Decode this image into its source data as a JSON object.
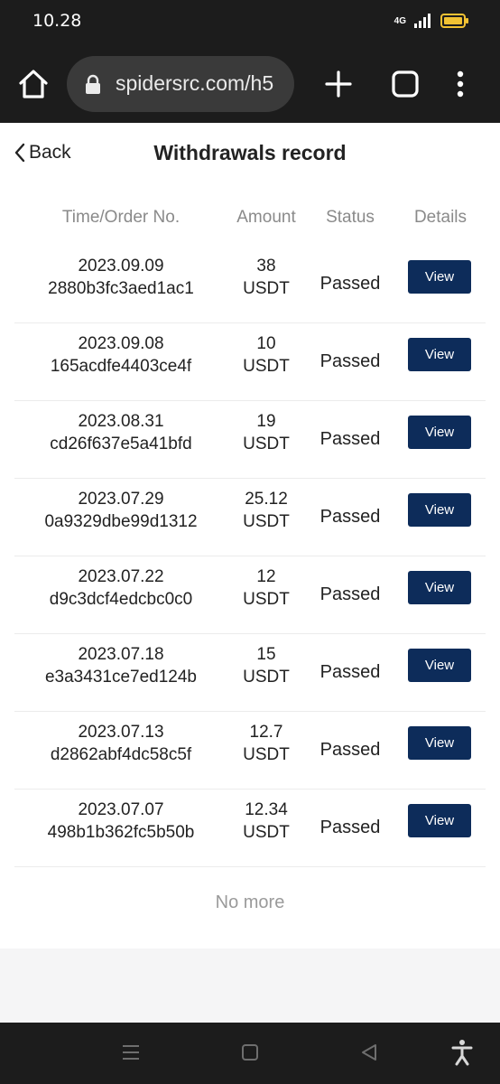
{
  "status_bar": {
    "time": "10.28",
    "network": "4G"
  },
  "browser": {
    "url": "spidersrc.com/h5"
  },
  "page": {
    "back_label": "Back",
    "title": "Withdrawals record",
    "columns": {
      "time": "Time/Order No.",
      "amount": "Amount",
      "status": "Status",
      "details": "Details"
    },
    "records": [
      {
        "date": "2023.09.09",
        "order": "2880b3fc3aed1ac1",
        "amount": "38",
        "unit": "USDT",
        "status": "Passed",
        "action": "View"
      },
      {
        "date": "2023.09.08",
        "order": "165acdfe4403ce4f",
        "amount": "10",
        "unit": "USDT",
        "status": "Passed",
        "action": "View"
      },
      {
        "date": "2023.08.31",
        "order": "cd26f637e5a41bfd",
        "amount": "19",
        "unit": "USDT",
        "status": "Passed",
        "action": "View"
      },
      {
        "date": "2023.07.29",
        "order": "0a9329dbe99d1312",
        "amount": "25.12",
        "unit": "USDT",
        "status": "Passed",
        "action": "View"
      },
      {
        "date": "2023.07.22",
        "order": "d9c3dcf4edcbc0c0",
        "amount": "12",
        "unit": "USDT",
        "status": "Passed",
        "action": "View"
      },
      {
        "date": "2023.07.18",
        "order": "e3a3431ce7ed124b",
        "amount": "15",
        "unit": "USDT",
        "status": "Passed",
        "action": "View"
      },
      {
        "date": "2023.07.13",
        "order": "d2862abf4dc58c5f",
        "amount": "12.7",
        "unit": "USDT",
        "status": "Passed",
        "action": "View"
      },
      {
        "date": "2023.07.07",
        "order": "498b1b362fc5b50b",
        "amount": "12.34",
        "unit": "USDT",
        "status": "Passed",
        "action": "View"
      }
    ],
    "footer_text": "No more"
  },
  "theme": {
    "accent": "#0d2c5a",
    "chrome": "#1c1c1c"
  }
}
